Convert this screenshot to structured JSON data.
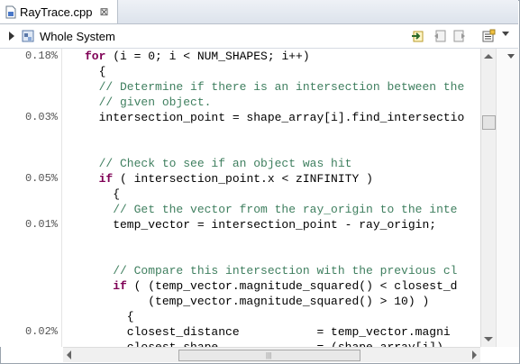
{
  "tab": {
    "label": "RayTrace.cpp",
    "close_glyph": "⊠"
  },
  "toolbar": {
    "label": "Whole System"
  },
  "gutter": [
    {
      "line": 0,
      "value": "0.18%"
    },
    {
      "line": 4,
      "value": "0.03%"
    },
    {
      "line": 8,
      "value": "0.05%"
    },
    {
      "line": 11,
      "value": "0.01%"
    },
    {
      "line": 18,
      "value": "0.02%"
    }
  ],
  "code": [
    "for (i = 0; i < NUM_SHAPES; i++)",
    "  {",
    "  // Determine if there is an intersection between the",
    "  // given object.",
    "  intersection_point = shape_array[i].find_intersectio",
    "",
    "",
    "  // Check to see if an object was hit",
    "  if ( intersection_point.x < zINFINITY )",
    "    {",
    "    // Get the vector from the ray_origin to the inte",
    "    temp_vector = intersection_point - ray_origin;",
    "",
    "",
    "    // Compare this intersection with the previous cl",
    "    if ( (temp_vector.magnitude_squared() < closest_d",
    "         (temp_vector.magnitude_squared() > 10) )",
    "      {",
    "      closest_distance           = temp_vector.magni",
    "      closest_shape              = (shape_array[i])"
  ],
  "colors": {
    "keyword": "#7f0055",
    "comment": "#3f7f5f"
  }
}
